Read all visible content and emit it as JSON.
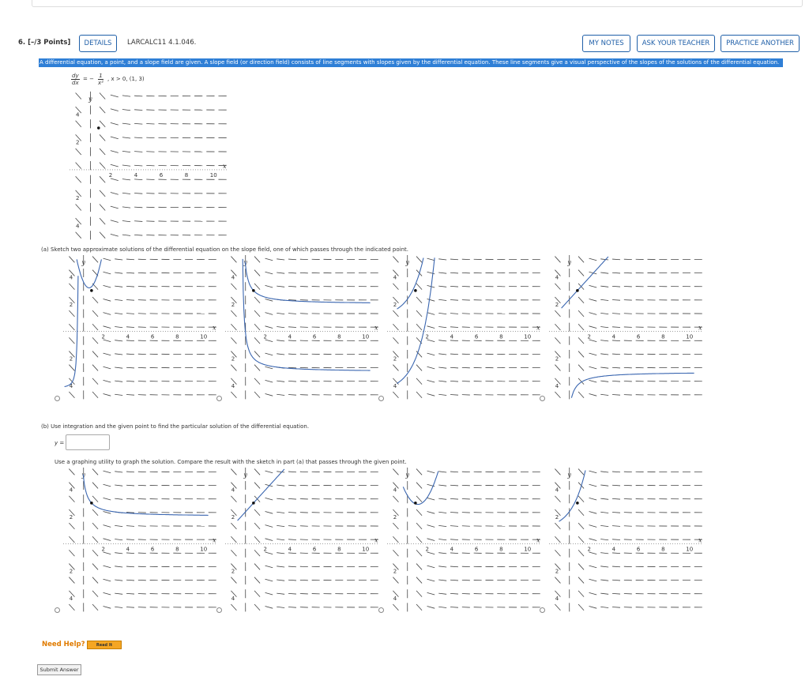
{
  "question": {
    "number": "6.",
    "points": "[–/3 Points]",
    "details_label": "DETAILS",
    "reference": "LARCALC11 4.1.046.",
    "my_notes_label": "MY NOTES",
    "ask_teacher_label": "ASK YOUR TEACHER",
    "practice_label": "PRACTICE ANOTHER"
  },
  "instructions": "A differential equation, a point, and a slope field are given. A slope field (or direction field) consists of line segments with slopes given by the differential equation. These line segments give a visual perspective of the slopes of the solutions of the differential equation.",
  "equation": {
    "lhs_num": "dy",
    "lhs_den": "dx",
    "equals": "= −",
    "rhs_num": "1",
    "rhs_den": "x²",
    "condition": ", x > 0,  (1, 3)"
  },
  "field_axes": {
    "x_label": "x",
    "y_label": "y",
    "x_ticks": [
      "2",
      "4",
      "6",
      "8",
      "10"
    ],
    "y_ticks": [
      "4",
      "2",
      "2",
      "4"
    ]
  },
  "part_a": {
    "prompt": "(a)  Sketch two approximate solutions of the differential equation on the slope field, one of which passes through the indicated point."
  },
  "part_b": {
    "prompt": "(b)  Use integration and the given point to find the particular solution of the differential equation.",
    "y_label": "y =",
    "answer_value": "",
    "graph_prompt": "Use a graphing utility to graph the solution. Compare the result with the sketch in part (a) that passes through the given point."
  },
  "help": {
    "need_help_label": "Need Help?",
    "read_it_label": "Read It"
  },
  "submit_label": "Submit Answer",
  "colors": {
    "accent": "#1f5fa8",
    "highlight": "#2f7fd6",
    "curve": "#3a66b0",
    "help": "#e07b00"
  },
  "fields": {
    "main": {
      "point": [
        1,
        3
      ],
      "curves": []
    },
    "part_a_options": [
      {
        "point": [
          1,
          3
        ],
        "curves": [
          {
            "type": "parabola",
            "vx": 0.8,
            "vy": 3.2,
            "k": 7,
            "x0": -0.5,
            "x1": 2.6
          },
          {
            "type": "branch",
            "x0": -1.2,
            "x1": -0.05,
            "yk": -4.2,
            "ys": 0.15
          }
        ]
      },
      {
        "point": [
          1,
          3
        ],
        "curves": [
          {
            "type": "recip",
            "c": 2,
            "s": 1
          },
          {
            "type": "recip",
            "c": -3,
            "s": 1
          }
        ]
      },
      {
        "point": [
          1,
          3
        ],
        "curves": [
          {
            "type": "exp",
            "c": 2.0,
            "b": 0.9
          },
          {
            "type": "exp",
            "c": -3.5,
            "b": 0.9
          }
        ]
      },
      {
        "point": [
          1,
          3
        ],
        "curves": [
          {
            "type": "line",
            "m": 1,
            "c": 2
          },
          {
            "type": "recip",
            "c": -3,
            "s": -1
          }
        ]
      }
    ],
    "part_b_options": [
      {
        "point": [
          1,
          3
        ],
        "curves": [
          {
            "type": "recip",
            "c": 2,
            "s": 1
          }
        ]
      },
      {
        "point": [
          1,
          3
        ],
        "curves": [
          {
            "type": "line",
            "m": 1,
            "c": 2
          }
        ]
      },
      {
        "point": [
          1,
          3
        ],
        "curves": [
          {
            "type": "parabola",
            "vx": 1.2,
            "vy": 2.9,
            "k": 3,
            "x0": 0,
            "x1": 3.2
          }
        ]
      },
      {
        "point": [
          1,
          3
        ],
        "curves": [
          {
            "type": "exp",
            "c": 2.0,
            "b": 0.9
          }
        ]
      }
    ]
  }
}
